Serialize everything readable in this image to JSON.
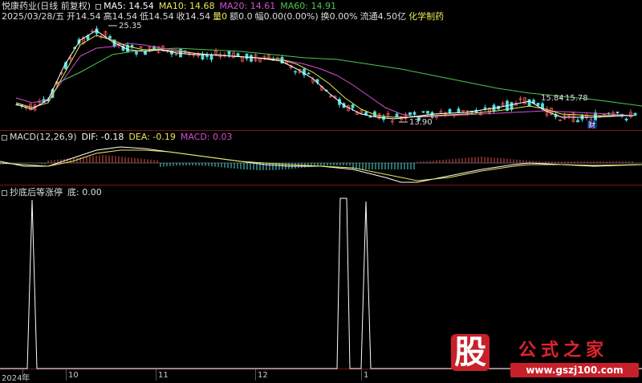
{
  "header": {
    "title": "悦康药业(日线 前复权)",
    "ma5": "MA5: 14.54",
    "ma10": "MA10: 14.68",
    "ma20": "MA20: 14.61",
    "ma60": "MA60: 14.91"
  },
  "info": {
    "date": "2025/03/28/五",
    "open": "开14.54",
    "high": "高14.54",
    "low": "低14.54",
    "close": "收14.54",
    "vol": "量0",
    "amount": "额0.0",
    "change": "幅0.00(0.00%)",
    "turnover": "换0.00%",
    "float": "流通4.50亿",
    "sector": "化学制药"
  },
  "price_annotations": {
    "high": "25.35",
    "low": "13.90",
    "range_left": "15.84",
    "range_right": "15.78",
    "finance_badge": "财"
  },
  "macd": {
    "title": "MACD(12,26,9)",
    "dif": "DIF: -0.18",
    "dea": "DEA: -0.19",
    "macd": "MACD: 0.03"
  },
  "indicator": {
    "title": "抄底后等涨停",
    "value": "底: 0.00"
  },
  "x_axis": {
    "labels": [
      "2024年",
      "10",
      "11",
      "12",
      "1"
    ]
  },
  "watermark": {
    "logo_char": "股",
    "title": "公式之家",
    "url": "www.gszj100.com"
  },
  "colors": {
    "ma5": "#ffffff",
    "ma10": "#e8e85a",
    "ma20": "#d44fd0",
    "ma60": "#4fc44f",
    "up": "#e05050",
    "down": "#4fe0e0",
    "grid": "#7a1515"
  }
}
